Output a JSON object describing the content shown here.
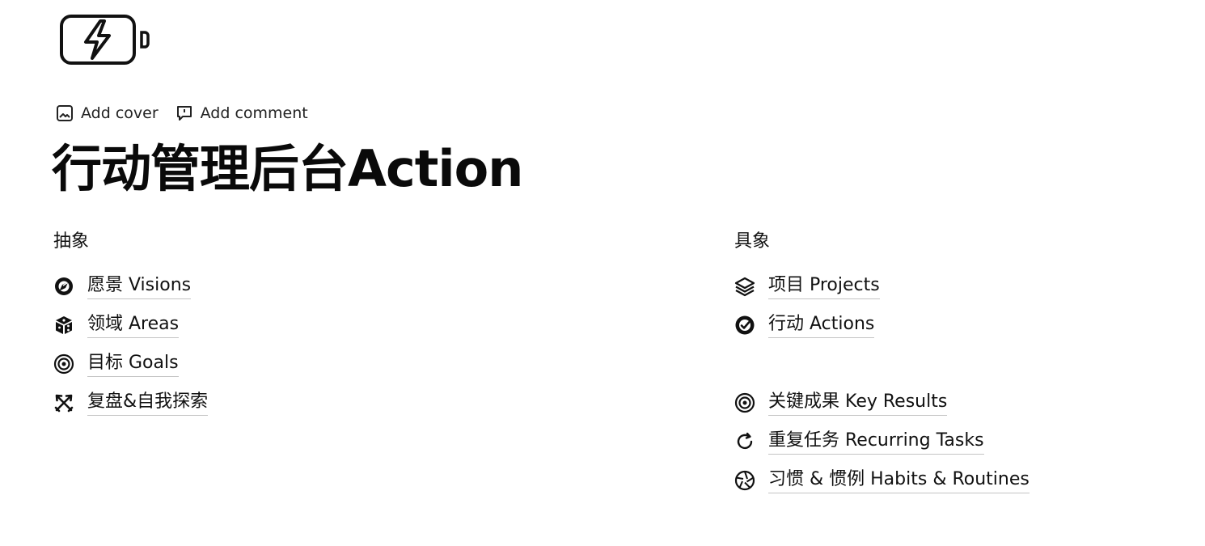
{
  "page": {
    "icon": "battery-charging-icon",
    "controls": {
      "add_cover": "Add cover",
      "add_comment": "Add comment"
    },
    "title": "行动管理后台Action"
  },
  "left_column": {
    "heading": "抽象",
    "links": [
      {
        "icon": "compass-icon",
        "label": "愿景 Visions"
      },
      {
        "icon": "cube-icon",
        "label": "领域 Areas"
      },
      {
        "icon": "target-icon",
        "label": "目标 Goals"
      },
      {
        "icon": "crossed-swords-icon",
        "label": "复盘&自我探索"
      }
    ]
  },
  "right_column": {
    "heading": "具象",
    "links_top": [
      {
        "icon": "layers-icon",
        "label": "项目 Projects"
      },
      {
        "icon": "check-circle-icon",
        "label": "行动 Actions"
      }
    ],
    "links_bottom": [
      {
        "icon": "target-icon",
        "label": "关键成果 Key Results"
      },
      {
        "icon": "refresh-icon",
        "label": "重复任务 Recurring Tasks"
      },
      {
        "icon": "aperture-icon",
        "label": "习惯 & 惯例 Habits & Routines"
      }
    ]
  }
}
